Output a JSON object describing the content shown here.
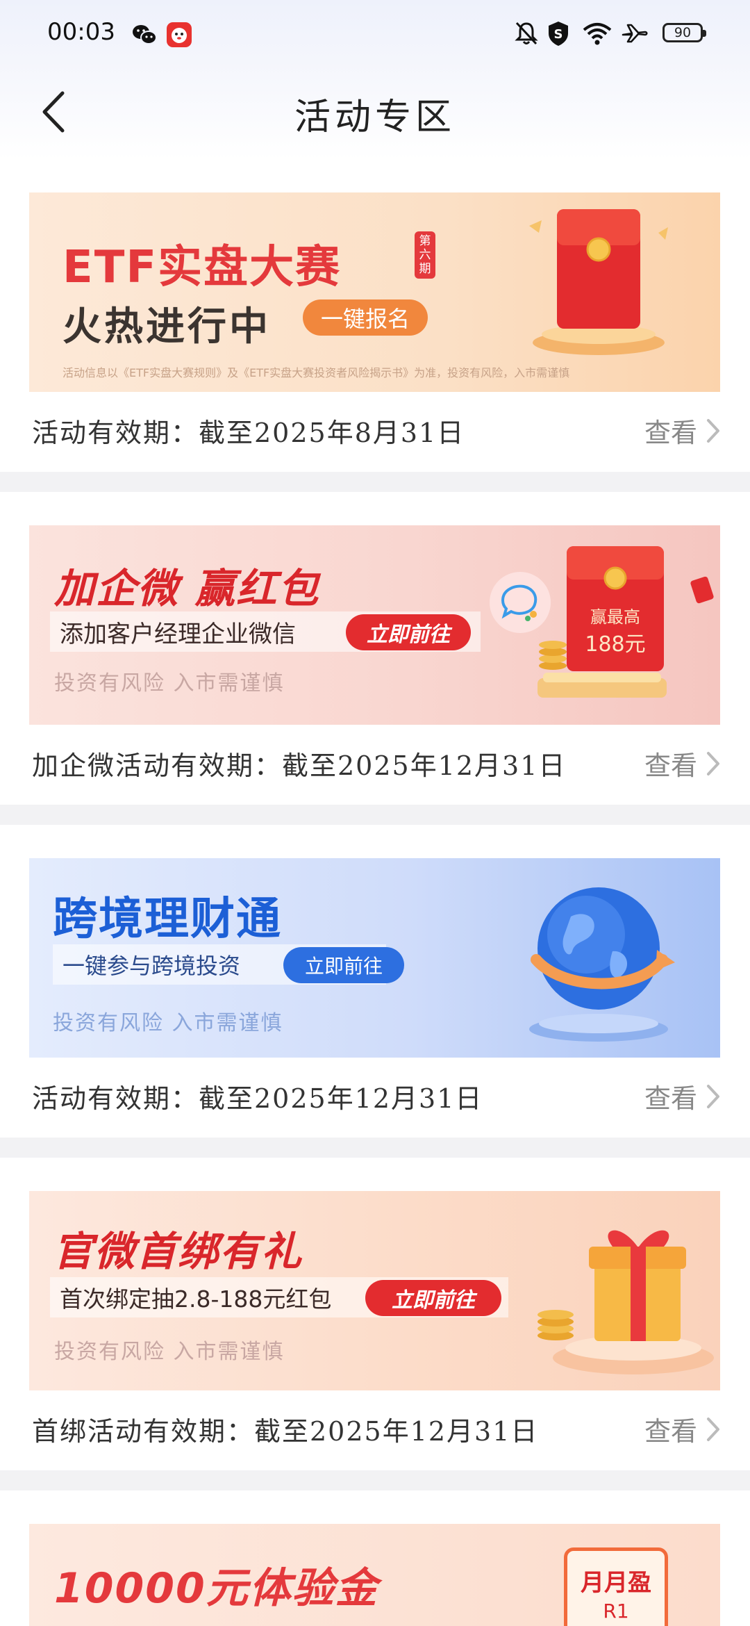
{
  "status_bar": {
    "time": "00:03",
    "battery": "90",
    "left_icons": [
      "wechat-icon",
      "app-mascot-icon"
    ],
    "right_icons": [
      "bell-mute-icon",
      "shield-icon",
      "wifi-icon",
      "airplane-icon",
      "battery-icon"
    ]
  },
  "header": {
    "title": "活动专区",
    "back_icon": "chevron-left-icon"
  },
  "view_label": "查看",
  "cards": [
    {
      "banner": {
        "headline": "ETF实盘大赛",
        "edition_badge": "第六期",
        "subheadline": "火热进行中",
        "cta": "一键报名",
        "disclaimer": "活动信息以《ETF实盘大赛规则》及《ETF实盘大赛投资者风险揭示书》为准，投资有风险，入市需谨慎",
        "colors": {
          "bg_from": "#fde9d8",
          "bg_to": "#fbd0a8",
          "headline": "#e4393c",
          "cta": "#f1873d"
        }
      },
      "validity": "活动有效期：截至2025年8月31日"
    },
    {
      "banner": {
        "headline": "加企微 赢红包",
        "subline": "添加客户经理企业微信",
        "cta": "立即前往",
        "risk": "投资有风险 入市需谨慎",
        "envelope_line1": "赢最高",
        "envelope_line2": "188元",
        "colors": {
          "bg_from": "#fbe1dc",
          "bg_to": "#f5c7c2",
          "headline": "#d9262b",
          "cta": "#e32c2f"
        }
      },
      "validity": "加企微活动有效期：截至2025年12月31日"
    },
    {
      "banner": {
        "headline": "跨境理财通",
        "subline": "一键参与跨境投资",
        "cta": "立即前往",
        "risk": "投资有风险 入市需谨慎",
        "colors": {
          "bg_from": "#dfe8fc",
          "bg_to": "#a9c3f6",
          "headline": "#1c5fd6",
          "cta": "#2d6fe0"
        }
      },
      "validity": "活动有效期：截至2025年12月31日"
    },
    {
      "banner": {
        "headline": "官微首绑有礼",
        "subline": "首次绑定抽2.8-188元红包",
        "cta": "立即前往",
        "risk": "投资有风险 入市需谨慎",
        "colors": {
          "bg_from": "#fde7dc",
          "bg_to": "#fbd3bd",
          "headline": "#d9262b",
          "cta": "#e32c2f"
        }
      },
      "validity": "首绑活动有效期：截至2025年12月31日"
    },
    {
      "banner": {
        "headline": "10000元体验金",
        "badge_line1": "月月盈",
        "badge_line2": "R1",
        "colors": {
          "bg_from": "#fde7dc",
          "headline": "#e4393c"
        }
      }
    }
  ]
}
